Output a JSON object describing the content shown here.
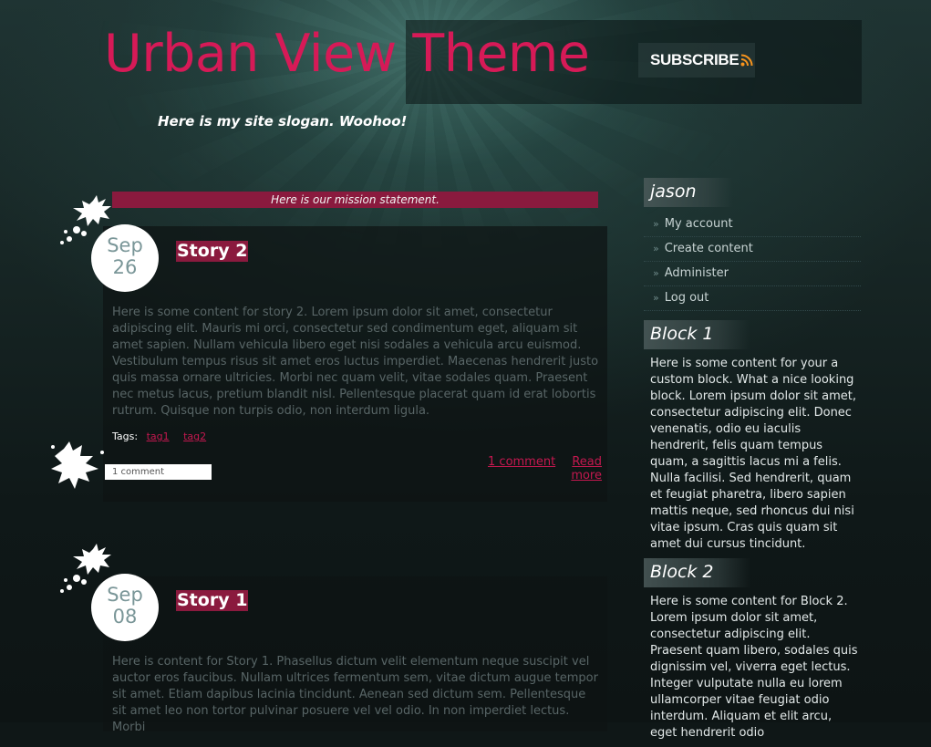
{
  "header": {
    "site_name": "Urban View Theme",
    "subscribe_label": "SUBSCRIBE",
    "slogan": "Here is my site slogan. Woohoo!"
  },
  "mission": "Here is our mission statement.",
  "colors": {
    "accent": "#d61a57",
    "title_bar": "#8a1a3e",
    "link": "#c4184f",
    "rss": "#f7941d"
  },
  "stories": [
    {
      "month": "Sep",
      "day": "26",
      "title": "Story 2",
      "body": "Here is some content for story 2. Lorem ipsum dolor sit amet, consectetur adipiscing elit. Mauris mi orci, consectetur sed condimentum eget, aliquam sit amet sapien. Nullam vehicula libero eget nisi sodales a vehicula arcu euismod. Vestibulum tempus risus sit amet eros luctus imperdiet. Maecenas hendrerit justo quis massa ornare ultricies. Morbi nec quam velit, vitae sodales quam. Praesent nec metus lacus, pretium blandit nisl. Pellentesque placerat quam id erat lobortis rutrum. Quisque non turpis odio, non interdum ligula.",
      "tags_label": "Tags:",
      "tags": [
        "tag1",
        "tag2"
      ],
      "comment_count": "1 comment",
      "comment_link": "1 comment",
      "read_more": "Read more"
    },
    {
      "month": "Sep",
      "day": "08",
      "title": "Story 1",
      "body": "Here is content for Story 1. Phasellus dictum velit elementum neque suscipit vel auctor eros faucibus. Nullam ultrices fermentum sem, vitae dictum augue tempor sit amet. Etiam dapibus lacinia tincidunt. Aenean sed dictum sem. Pellentesque sit amet leo non tortor pulvinar posuere vel vel odio. In non imperdiet lectus. Morbi"
    }
  ],
  "sidebar": {
    "user_block": {
      "title": "jason",
      "items": [
        "My account",
        "Create content",
        "Administer",
        "Log out"
      ]
    },
    "block1": {
      "title": "Block 1",
      "body": "Here is some content for your a custom block. What a nice looking block. Lorem ipsum dolor sit amet, consectetur adipiscing elit. Donec venenatis, odio eu iaculis hendrerit, felis quam tempus quam, a sagittis lacus mi a felis. Nulla facilisi. Sed hendrerit, quam et feugiat pharetra, libero sapien mattis neque, sed rhoncus dui nisi vitae ipsum. Cras quis quam sit amet dui cursus tincidunt."
    },
    "block2": {
      "title": "Block 2",
      "body": "Here is some content for Block 2. Lorem ipsum dolor sit amet, consectetur adipiscing elit. Praesent quam libero, sodales quis dignissim vel, viverra eget lectus. Integer vulputate nulla eu lorem ullamcorper vitae feugiat odio interdum. Aliquam et elit arcu, eget hendrerit odio"
    }
  }
}
